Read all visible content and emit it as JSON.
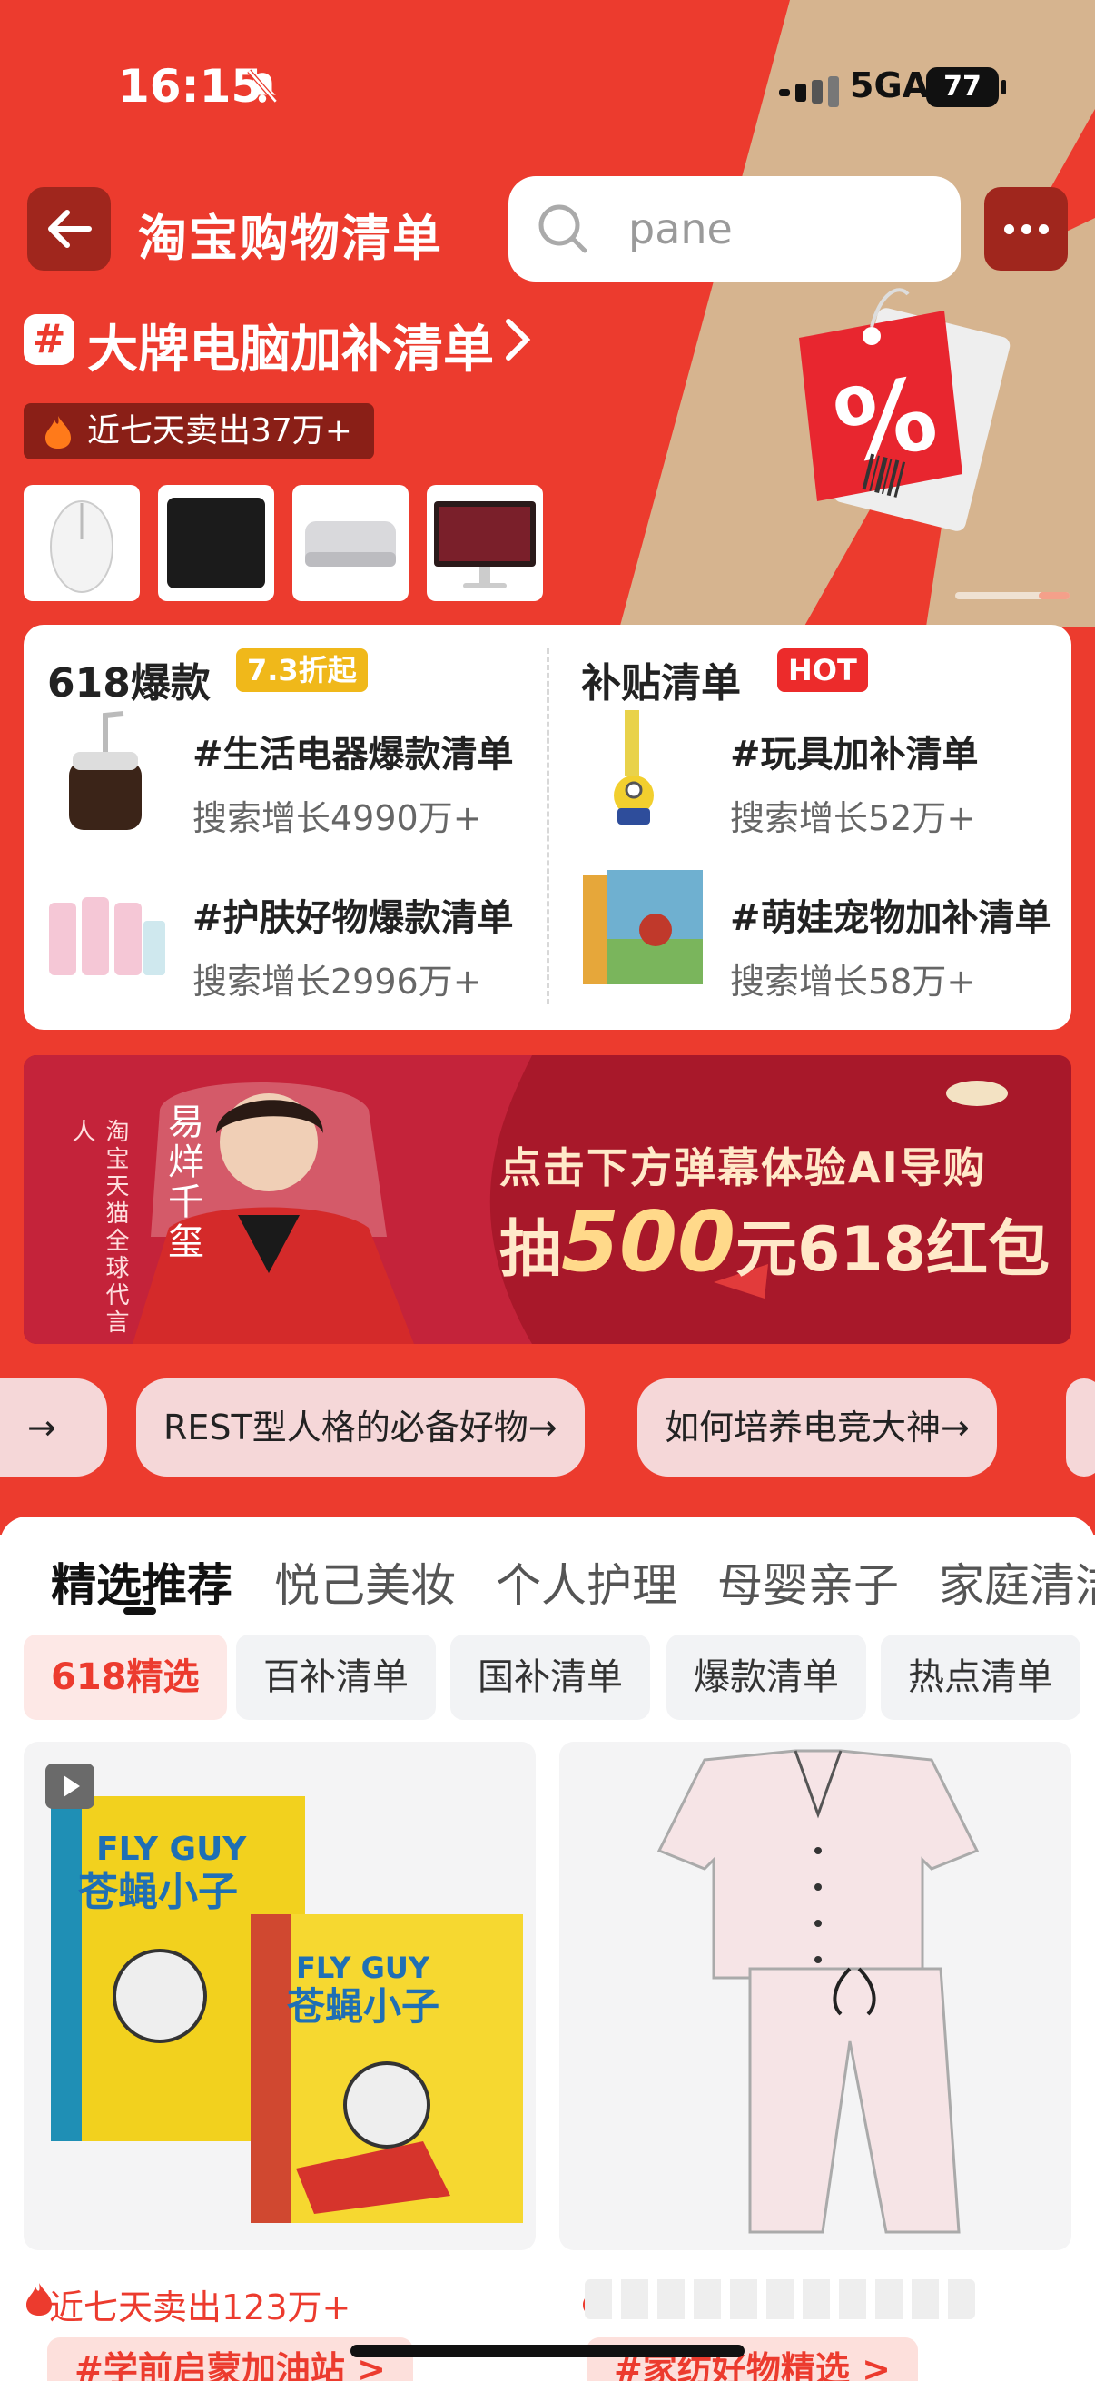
{
  "status": {
    "time": "16:15",
    "network": "5GA",
    "battery": "77"
  },
  "header": {
    "title": "淘宝购物清单",
    "search_placeholder": "pane"
  },
  "promo": {
    "title": "大牌电脑加补清单",
    "sold": "近七天卖出37万+",
    "thumbs": [
      "mouse",
      "mousepad",
      "mini-pc",
      "monitor"
    ]
  },
  "card": {
    "left": {
      "heading": "618爆款",
      "badge": "7.3折起",
      "items": [
        {
          "title": "#生活电器爆款清单",
          "sub": "搜索增长4990万+"
        },
        {
          "title": "#护肤好物爆款清单",
          "sub": "搜索增长2996万+"
        }
      ]
    },
    "right": {
      "heading": "补贴清单",
      "badge": "HOT",
      "items": [
        {
          "title": "#玩具加补清单",
          "sub": "搜索增长52万+"
        },
        {
          "title": "#萌娃宠物加补清单",
          "sub": "搜索增长58万+"
        }
      ]
    }
  },
  "banner": {
    "side_text": "淘宝天猫全球代言人",
    "name": "易烊千玺",
    "line1": "点击下方弹幕体验AI导购",
    "line2_prefix": "抽",
    "line2_big": "500",
    "line2_suffix": "元618红包"
  },
  "chips": [
    "→",
    "REST型人格的必备好物→",
    "如何培养电竞大神→"
  ],
  "tabs": [
    "精选推荐",
    "悦己美妆",
    "个人护理",
    "母婴亲子",
    "家庭清洁"
  ],
  "segments": [
    "618精选",
    "百补清单",
    "国补清单",
    "爆款清单",
    "热点清单"
  ],
  "products": {
    "left_sales": "近七天卖出123万+",
    "book_title": "苍蝇小子",
    "book_en": "FLY GUY",
    "hashtags": [
      "#学前启蒙加油站 >",
      "#家纺好物精选 >"
    ]
  },
  "colors": {
    "brand_red": "#ec3b2e",
    "gold": "#f0b81a",
    "dark_red": "#a0261d"
  }
}
